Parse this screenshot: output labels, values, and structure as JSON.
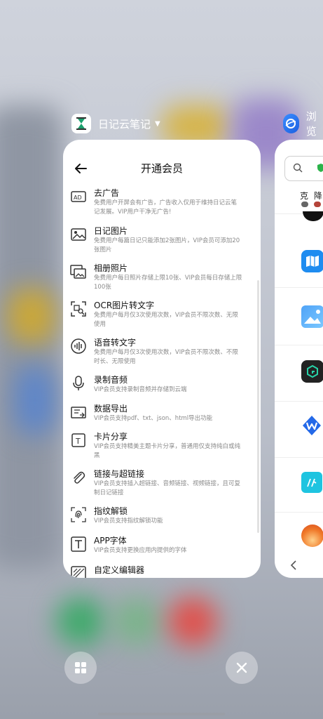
{
  "left_app": {
    "title": "日记云笔记"
  },
  "right_app": {
    "title": "浏览"
  },
  "card": {
    "title": "开通会员",
    "items": [
      {
        "title": "去广告",
        "desc": "免费用户开屏会有广告，广告收入仅用于维持日记云笔记发展。VIP用户干净无广告!",
        "icon": "ad-icon"
      },
      {
        "title": "日记图片",
        "desc": "免费用户每篇日记只能添加2张图片，VIP会员可添加20张图片",
        "icon": "image-icon"
      },
      {
        "title": "相册照片",
        "desc": "免费用户每日照片存储上限10张、VIP会员每日存储上限100张",
        "icon": "album-icon"
      },
      {
        "title": "OCR图片转文字",
        "desc": "免费用户每月仅3次使用次数，VIP会员不限次数、无限使用",
        "icon": "ocr-icon"
      },
      {
        "title": "语音转文字",
        "desc": "免费用户每月仅3次使用次数，VIP会员不限次数、不限时长、无限使用",
        "icon": "voice-icon"
      },
      {
        "title": "录制音频",
        "desc": "VIP会员支持录制音频并存储到云端",
        "icon": "microphone-icon"
      },
      {
        "title": "数据导出",
        "desc": "VIP会员支持pdf、txt、json、html导出功能",
        "icon": "export-icon"
      },
      {
        "title": "卡片分享",
        "desc": "VIP会员支持精美主题卡片分享，普通用仅支持纯白或纯黑",
        "icon": "card-share-icon"
      },
      {
        "title": "链接与超链接",
        "desc": "VIP会员支持插入超链接、音频链接、视频链接，且可复制日记链接",
        "icon": "paperclip-icon"
      },
      {
        "title": "指纹解锁",
        "desc": "VIP会员支持指纹解锁功能",
        "icon": "fingerprint-icon"
      },
      {
        "title": "APP字体",
        "desc": "VIP会员支持更换应用内提供的字体",
        "icon": "font-icon"
      },
      {
        "title": "自定义编辑器",
        "desc": "",
        "icon": "editor-icon"
      }
    ]
  },
  "right_card": {
    "search_chars": "克 降"
  }
}
